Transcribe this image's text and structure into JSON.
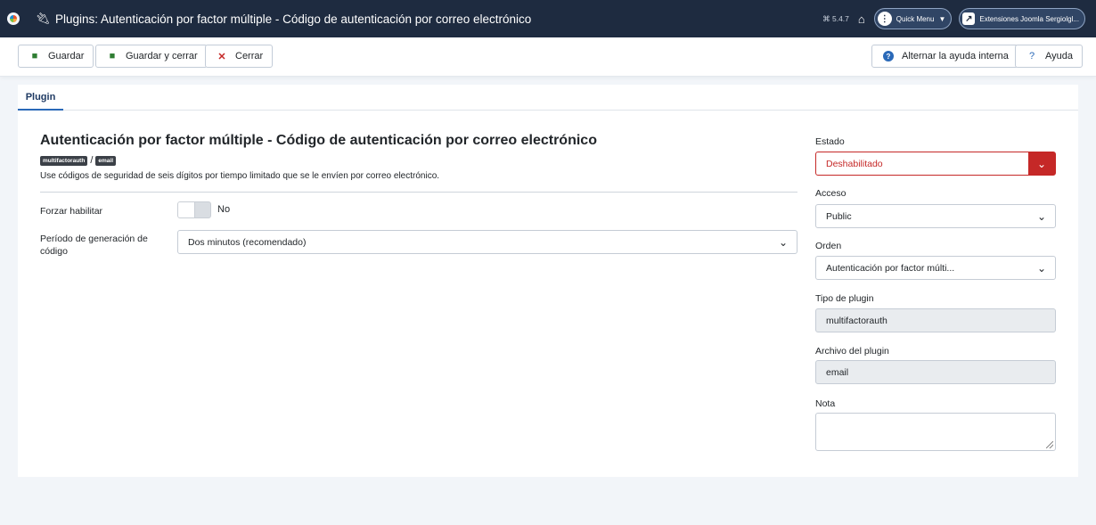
{
  "header": {
    "title": "Plugins: Autenticación por factor múltiple - Código de autenticación por correo electrónico",
    "title_icon": "plug-icon",
    "version": "⌘ 5.4.7",
    "quick_menu": "Quick Menu",
    "site_link": "Extensiones Joomla Sergiolgl..."
  },
  "toolbar": {
    "save": "Guardar",
    "save_close": "Guardar y cerrar",
    "close": "Cerrar",
    "toggle_help": "Alternar la ayuda interna",
    "help": "Ayuda"
  },
  "tabs": [
    "Plugin"
  ],
  "plugin": {
    "title": "Autenticación por factor múltiple - Código de autenticación por correo electrónico",
    "tag_folder": "multifactorauth",
    "tag_separator": "/",
    "tag_element": "email",
    "description": "Use códigos de seguridad de seis dígitos por tiempo limitado que se le envíen por correo electrónico."
  },
  "fields": {
    "force_enable_label": "Forzar habilitar",
    "force_enable_value": "No",
    "period_label": "Período de generación de código",
    "period_value": "Dos minutos (recomendado)"
  },
  "sidebar": {
    "status_label": "Estado",
    "status_value": "Deshabilitado",
    "access_label": "Acceso",
    "access_value": "Public",
    "order_label": "Orden",
    "order_value": "Autenticación por factor múlti...",
    "plugin_type_label": "Tipo de plugin",
    "plugin_type_value": "multifactorauth",
    "plugin_file_label": "Archivo del plugin",
    "plugin_file_value": "email",
    "note_label": "Nota",
    "note_value": ""
  },
  "colors": {
    "header_bg": "#1e2b40",
    "danger": "#c52827",
    "save_icon": "#2f7d32",
    "help_icon": "#2a69b8"
  }
}
